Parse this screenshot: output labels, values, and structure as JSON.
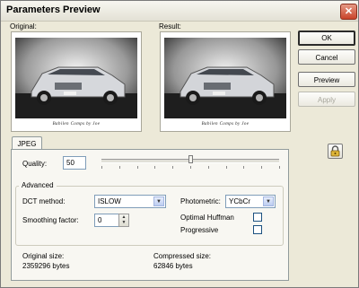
{
  "window": {
    "title": "Parameters Preview",
    "close_glyph": "✕"
  },
  "previews": {
    "original_label": "Original:",
    "result_label": "Result:",
    "caption": "Babilen Comps by Joe"
  },
  "buttons": {
    "ok": "OK",
    "cancel": "Cancel",
    "preview": "Preview",
    "apply": "Apply"
  },
  "tabs": [
    {
      "label": "JPEG"
    }
  ],
  "jpeg": {
    "quality_label": "Quality:",
    "quality_value": "50",
    "quality_slider_fraction": 0.5,
    "advanced": {
      "title": "Advanced",
      "dct_label": "DCT method:",
      "dct_value": "ISLOW",
      "smoothing_label": "Smoothing factor:",
      "smoothing_value": "0",
      "photometric_label": "Photometric:",
      "photometric_value": "YCbCr",
      "optimal_huffman_label": "Optimal Huffman",
      "optimal_huffman_checked": false,
      "progressive_label": "Progressive",
      "progressive_checked": false
    },
    "original_size_label": "Original size:",
    "original_size_value": "2359296 bytes",
    "compressed_size_label": "Compressed size:",
    "compressed_size_value": "62846 bytes"
  },
  "icons": {
    "close": "close-icon",
    "lock": "lock-icon",
    "dropdown": "chevron-down-icon"
  }
}
